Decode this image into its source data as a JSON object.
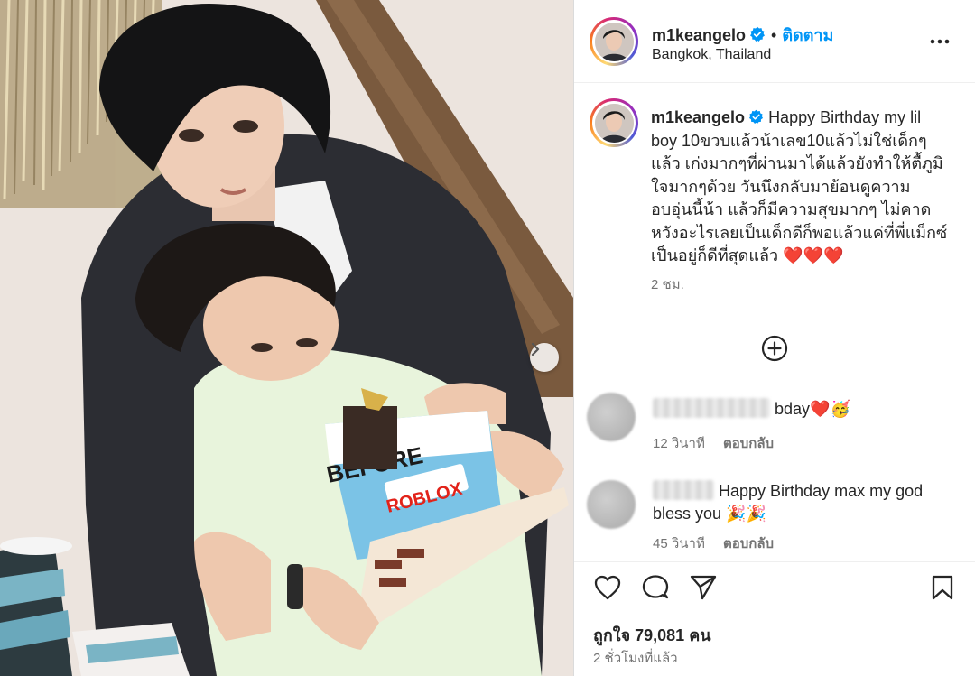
{
  "post": {
    "username": "m1keangelo",
    "follow_label": "ติดตาม",
    "location": "Bangkok, Thailand",
    "caption": "Happy Birthday my lil boy 10ขวบแล้วน้าเลข10แล้วไม่ใช่เด็กๆแล้ว เก่งมากๆที่ผ่านมาได้แล้วยังทำให้ตื้ภูมิใจมากๆด้วย วันนึงกลับมาย้อนดูความอบอุ่นนี้น้า แล้วก็มีความสุขมากๆ ไม่คาดหวังอะไรเลยเป็นเด็กดีก็พอแล้วแค่ที่พี่แม็กซ์เป็นอยู่ก็ดีที่สุดแล้ว",
    "caption_emojis": "❤️❤️❤️",
    "caption_time": "2 ชม.",
    "likes_label": "ถูกใจ 79,081 คน",
    "posted_ago": "2 ชั่วโมงที่แล้ว"
  },
  "comments": [
    {
      "text": "bday",
      "emojis": "❤️🥳",
      "time": "12 วินาที",
      "reply_label": "ตอบกลับ"
    },
    {
      "text": "Happy Birthday max my god bless you",
      "emojis": "🎉🎉",
      "time": "45 วินาที",
      "reply_label": "ตอบกลับ"
    }
  ],
  "photo": {
    "cake_text_top": "BEFORE",
    "cake_brand": "ROBLOX"
  },
  "colors": {
    "link_blue": "#0095f6",
    "verified_blue": "#0095f6",
    "secondary_text": "#737373",
    "heart_red": "#e0142a"
  },
  "icons": [
    "verified-badge-icon",
    "more-options-icon",
    "add-circle-icon",
    "heart-icon",
    "comment-icon",
    "share-icon",
    "bookmark-icon",
    "chevron-right-icon"
  ]
}
